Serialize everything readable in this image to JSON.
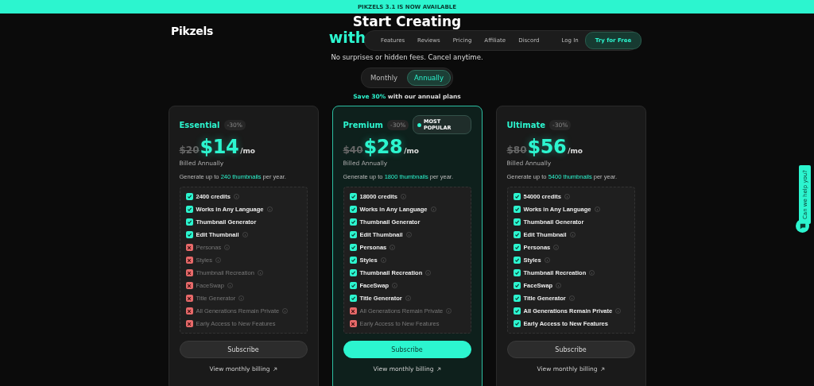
{
  "banner": {
    "text": "PIKZELS 3.1 IS NOW AVAILABLE"
  },
  "logo": {
    "text": "Pikzels"
  },
  "nav": {
    "links": [
      "Features",
      "Reviews",
      "Pricing",
      "Affiliate",
      "Discord"
    ],
    "login": "Log In",
    "cta": "Try for Free"
  },
  "hero": {
    "line_1": "Start Creating",
    "line_2": "with",
    "subtitle": "No surprises or hidden fees. Cancel anytime."
  },
  "billing_toggle": [
    {
      "label": "Monthly",
      "selected": false
    },
    {
      "label": "Annually",
      "selected": true
    }
  ],
  "save_note": {
    "highlight": "Save 30%",
    "rest": "with our annual plans"
  },
  "plans": [
    {
      "name": "Essential",
      "discount": "-30%",
      "old_price": "$20",
      "price": "$14",
      "period": "/mo",
      "billed": "Billed Annually",
      "generate_prefix": "Generate up to",
      "generate_highlight": "240 thumbnails",
      "generate_suffix": "per year.",
      "highlighted": false,
      "cta": "Subscribe",
      "link": "View monthly billing",
      "features": [
        {
          "label": "2400 credits",
          "included": true,
          "info": true
        },
        {
          "label": "Works in Any Language",
          "included": true,
          "info": true
        },
        {
          "label": "Thumbnail Generator",
          "included": true,
          "info": false
        },
        {
          "label": "Edit Thumbnail",
          "included": true,
          "info": true
        },
        {
          "label": "Personas",
          "included": false,
          "info": true
        },
        {
          "label": "Styles",
          "included": false,
          "info": true
        },
        {
          "label": "Thumbnail Recreation",
          "included": false,
          "info": true
        },
        {
          "label": "FaceSwap",
          "included": false,
          "info": true
        },
        {
          "label": "Title Generator",
          "included": false,
          "info": true
        },
        {
          "label": "All Generations Remain Private",
          "included": false,
          "info": true
        },
        {
          "label": "Early Access to New Features",
          "included": false,
          "info": false
        }
      ]
    },
    {
      "name": "Premium",
      "discount": "-30%",
      "badge": "MOST POPULAR",
      "old_price": "$40",
      "price": "$28",
      "period": "/mo",
      "billed": "Billed Annually",
      "generate_prefix": "Generate up to",
      "generate_highlight": "1800 thumbnails",
      "generate_suffix": "per year.",
      "highlighted": true,
      "cta": "Subscribe",
      "link": "View monthly billing",
      "features": [
        {
          "label": "18000 credits",
          "included": true,
          "info": true
        },
        {
          "label": "Works in Any Language",
          "included": true,
          "info": true
        },
        {
          "label": "Thumbnail Generator",
          "included": true,
          "info": false
        },
        {
          "label": "Edit Thumbnail",
          "included": true,
          "info": true
        },
        {
          "label": "Personas",
          "included": true,
          "info": true
        },
        {
          "label": "Styles",
          "included": true,
          "info": true
        },
        {
          "label": "Thumbnail Recreation",
          "included": true,
          "info": true
        },
        {
          "label": "FaceSwap",
          "included": true,
          "info": true
        },
        {
          "label": "Title Generator",
          "included": true,
          "info": true
        },
        {
          "label": "All Generations Remain Private",
          "included": false,
          "info": true
        },
        {
          "label": "Early Access to New Features",
          "included": false,
          "info": false
        }
      ]
    },
    {
      "name": "Ultimate",
      "discount": "-30%",
      "old_price": "$80",
      "price": "$56",
      "period": "/mo",
      "billed": "Billed Annually",
      "generate_prefix": "Generate up to",
      "generate_highlight": "5400 thumbnails",
      "generate_suffix": "per year.",
      "highlighted": false,
      "cta": "Subscribe",
      "link": "View monthly billing",
      "features": [
        {
          "label": "54000 credits",
          "included": true,
          "info": true
        },
        {
          "label": "Works in Any Language",
          "included": true,
          "info": true
        },
        {
          "label": "Thumbnail Generator",
          "included": true,
          "info": false
        },
        {
          "label": "Edit Thumbnail",
          "included": true,
          "info": true
        },
        {
          "label": "Personas",
          "included": true,
          "info": true
        },
        {
          "label": "Styles",
          "included": true,
          "info": true
        },
        {
          "label": "Thumbnail Recreation",
          "included": true,
          "info": true
        },
        {
          "label": "FaceSwap",
          "included": true,
          "info": true
        },
        {
          "label": "Title Generator",
          "included": true,
          "info": true
        },
        {
          "label": "All Generations Remain Private",
          "included": true,
          "info": true
        },
        {
          "label": "Early Access to New Features",
          "included": true,
          "info": false
        }
      ]
    }
  ],
  "help_tab": {
    "text": "Can we help you?"
  }
}
